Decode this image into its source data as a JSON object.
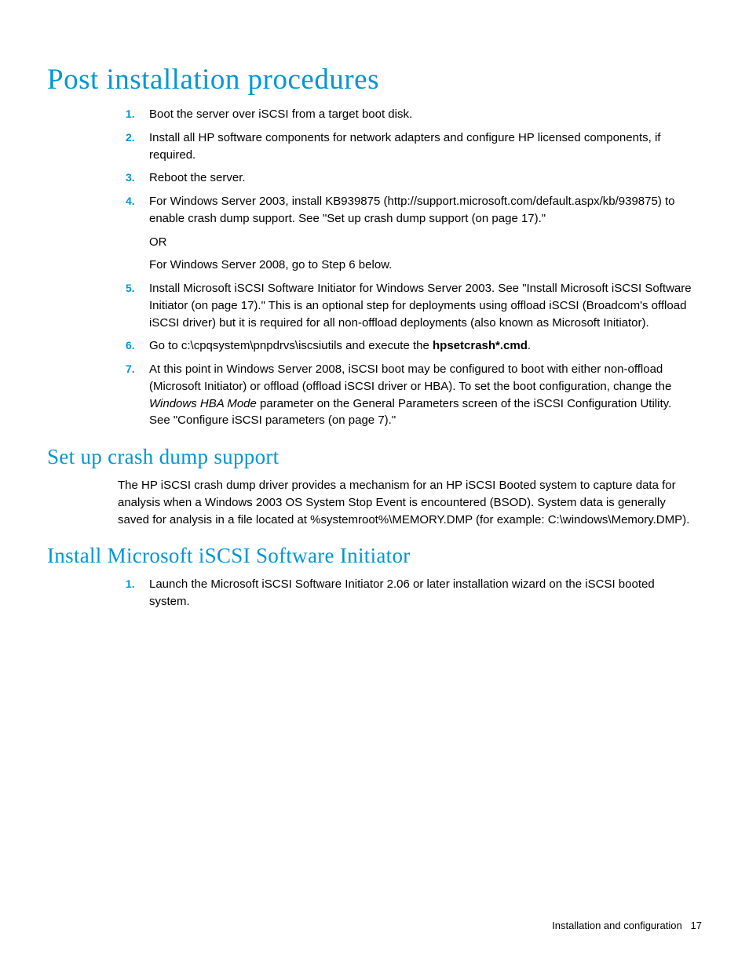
{
  "h1": "Post installation procedures",
  "list1": {
    "i1": {
      "n": "1.",
      "t": "Boot the server over iSCSI from a target boot disk."
    },
    "i2": {
      "n": "2.",
      "t": "Install all HP software components for network adapters and configure HP licensed components, if required."
    },
    "i3": {
      "n": "3.",
      "t": "Reboot the server."
    },
    "i4": {
      "n": "4.",
      "p1": "For Windows Server 2003, install KB939875 (http://support.microsoft.com/default.aspx/kb/939875) to enable crash dump support. See \"Set up crash dump support (on page 17).\"",
      "p2": "OR",
      "p3": "For Windows Server 2008, go to Step 6 below."
    },
    "i5": {
      "n": "5.",
      "t": "Install Microsoft iSCSI Software Initiator for Windows Server 2003. See \"Install Microsoft iSCSI Software Initiator (on page 17).\" This is an optional step for deployments using offload iSCSI (Broadcom's offload iSCSI driver) but it is required for all non-offload deployments (also known as Microsoft Initiator)."
    },
    "i6": {
      "n": "6.",
      "pre": "Go to c:\\cpqsystem\\pnpdrvs\\iscsiutils and execute the ",
      "bold": "hpsetcrash*.cmd",
      "post": "."
    },
    "i7": {
      "n": "7.",
      "pre": "At this point in Windows Server 2008, iSCSI boot may be configured to boot with either non-offload (Microsoft Initiator) or offload (offload iSCSI driver or HBA). To set the boot configuration, change the ",
      "italic": "Windows HBA Mode",
      "post": " parameter on the General Parameters screen of the iSCSI Configuration Utility. See \"Configure iSCSI parameters (on page 7).\""
    }
  },
  "h2a": "Set up crash dump support",
  "para_a": "The HP iSCSI crash dump driver provides a mechanism for an HP iSCSI Booted system to capture data for analysis when a Windows 2003 OS System Stop Event is encountered (BSOD). System data is generally saved for analysis in a file located at %systemroot%\\MEMORY.DMP (for example: C:\\windows\\Memory.DMP).",
  "h2b": "Install Microsoft iSCSI Software Initiator",
  "list2": {
    "i1": {
      "n": "1.",
      "t": "Launch the Microsoft iSCSI Software Initiator 2.06 or later installation wizard on the iSCSI booted system."
    }
  },
  "footer": {
    "section": "Installation and configuration",
    "page": "17"
  }
}
